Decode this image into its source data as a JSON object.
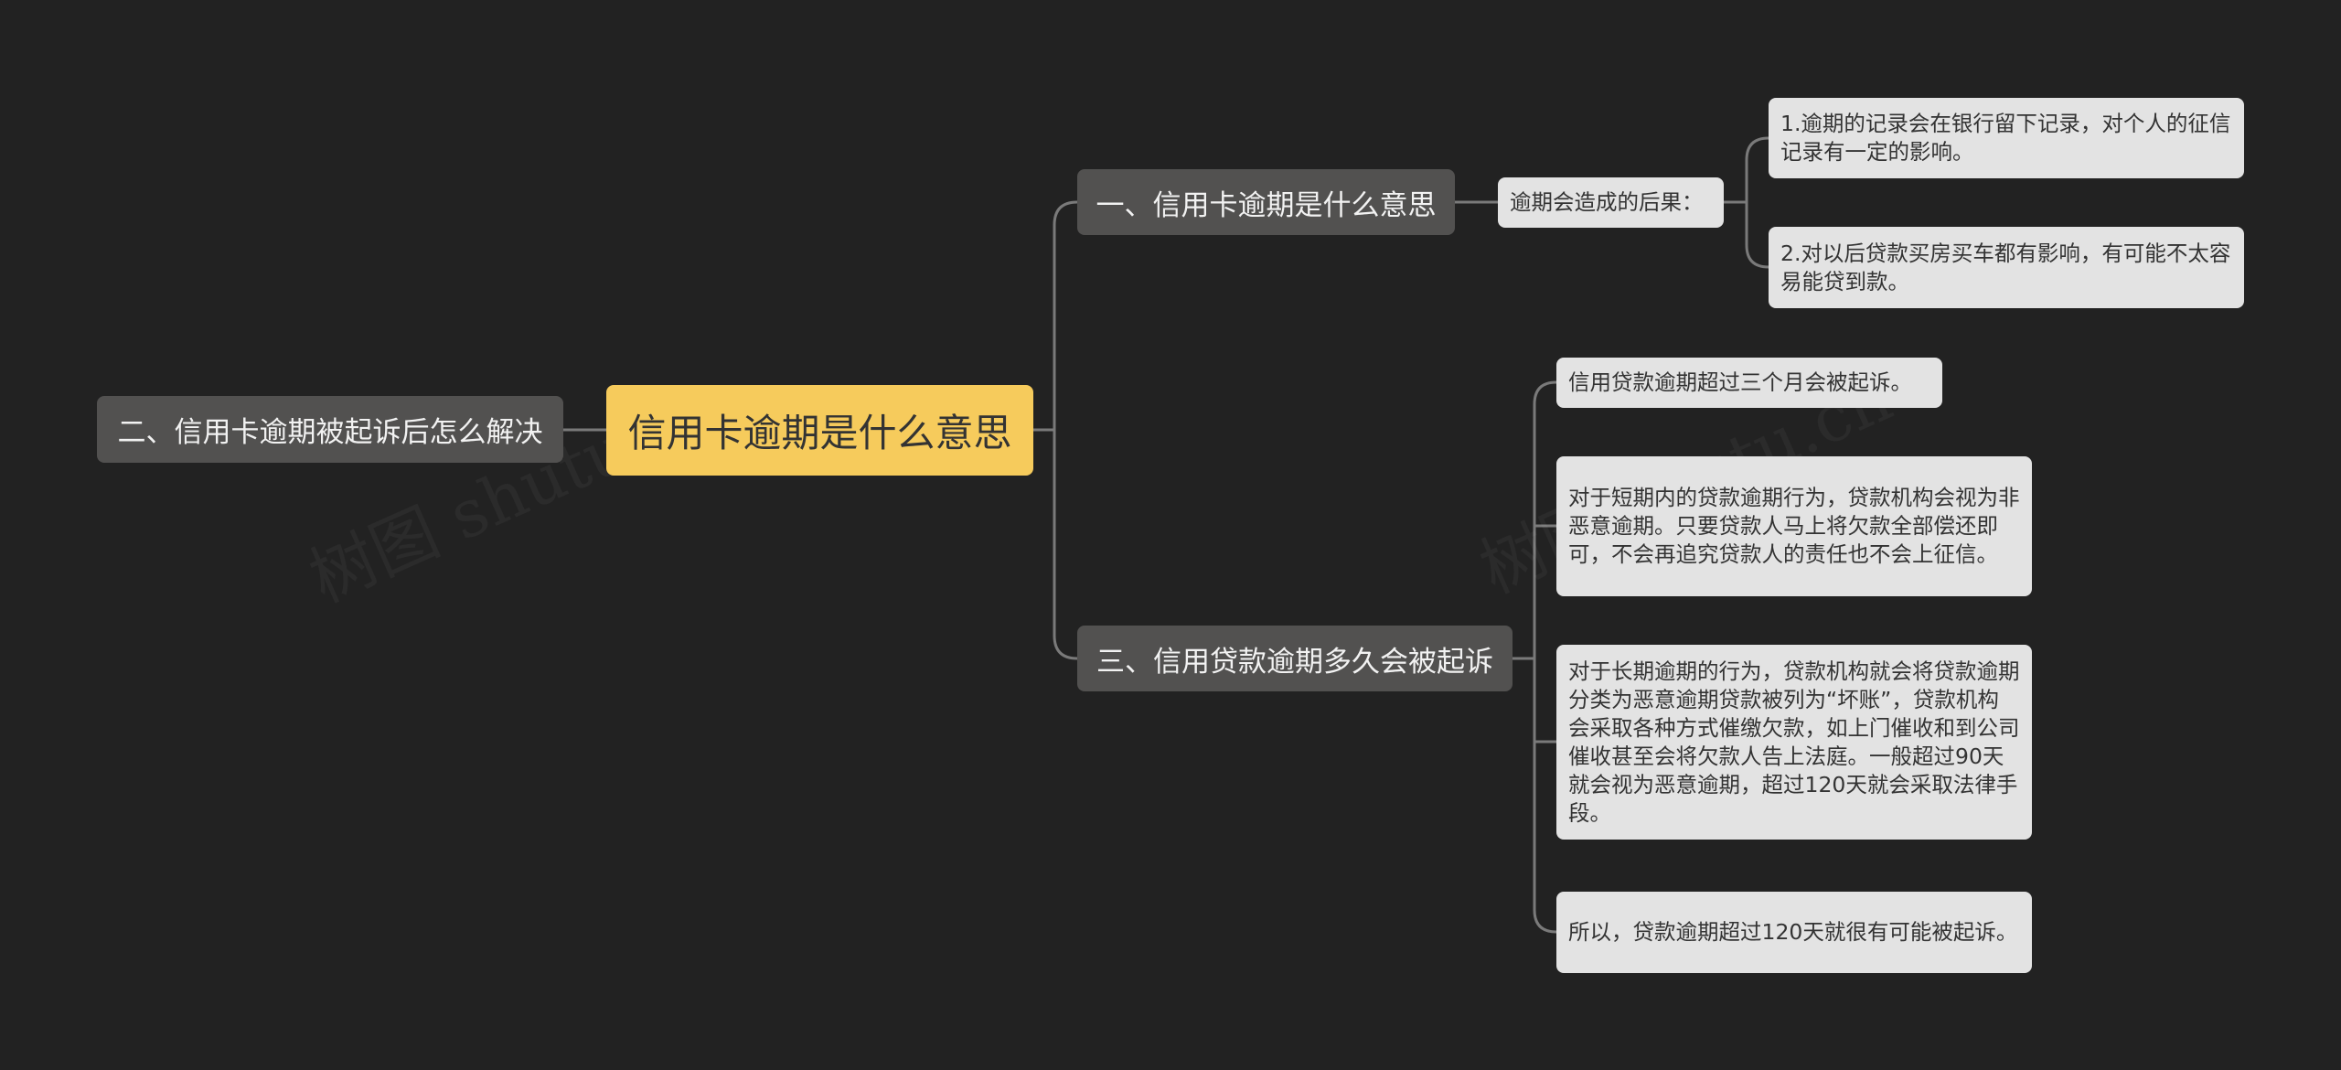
{
  "mindmap": {
    "root": "信用卡逾期是什么意思",
    "branches": [
      {
        "label": "一、信用卡逾期是什么意思",
        "sub": "逾期会造成的后果：",
        "children": [
          "1.逾期的记录会在银行留下记录，对个人的征信记录有一定的影响。",
          "2.对以后贷款买房买车都有影响，有可能不太容易能贷到款。"
        ]
      },
      {
        "label": "二、信用卡逾期被起诉后怎么解决"
      },
      {
        "label": "三、信用贷款逾期多久会被起诉",
        "children": [
          "信用贷款逾期超过三个月会被起诉。",
          "对于短期内的贷款逾期行为，贷款机构会视为非恶意逾期。只要贷款人马上将欠款全部偿还即可，不会再追究贷款人的责任也不会上征信。",
          "对于长期逾期的行为，贷款机构就会将贷款逾期分类为恶意逾期贷款被列为“坏账”，贷款机构会采取各种方式催缴欠款，如上门催收和到公司催收甚至会将欠款人告上法庭。一般超过90天就会视为恶意逾期，超过120天就会采取法律手段。",
          "所以，贷款逾期超过120天就很有可能被起诉。"
        ]
      }
    ]
  },
  "watermark": "树图 shutu.cn",
  "colors": {
    "background": "#222222",
    "root_fill": "#f6cb5c",
    "branch_fill": "#525150",
    "leaf_fill": "#e3e3e3",
    "connector": "#7a7a7a"
  }
}
